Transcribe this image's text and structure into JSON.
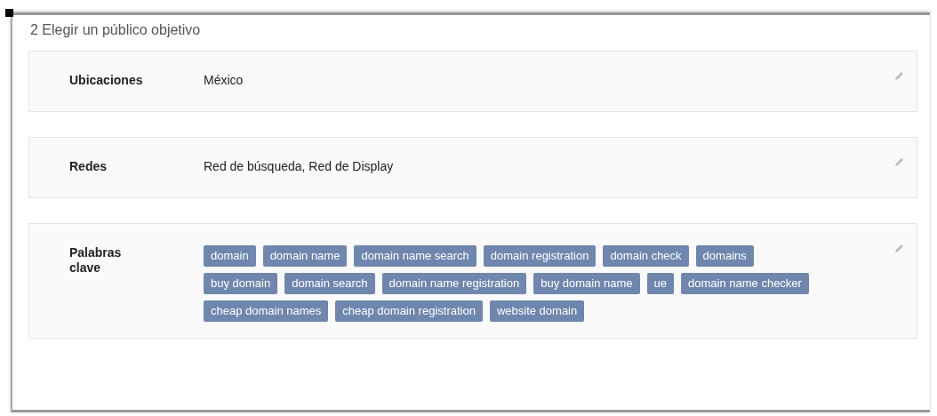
{
  "title": "2 Elegir un público objetivo",
  "sections": [
    {
      "label": "Ubicaciones",
      "kind": "text",
      "value": "México"
    },
    {
      "label": "Redes",
      "kind": "text",
      "value": "Red de búsqueda, Red de Display"
    },
    {
      "label": "Palabras clave",
      "kind": "tags",
      "tags": [
        "domain",
        "domain name",
        "domain name search",
        "domain registration",
        "domain check",
        "domains",
        "buy domain",
        "domain search",
        "domain name registration",
        "buy domain name",
        "ue",
        "domain name checker",
        "cheap domain names",
        "cheap domain registration",
        "website domain"
      ]
    }
  ]
}
